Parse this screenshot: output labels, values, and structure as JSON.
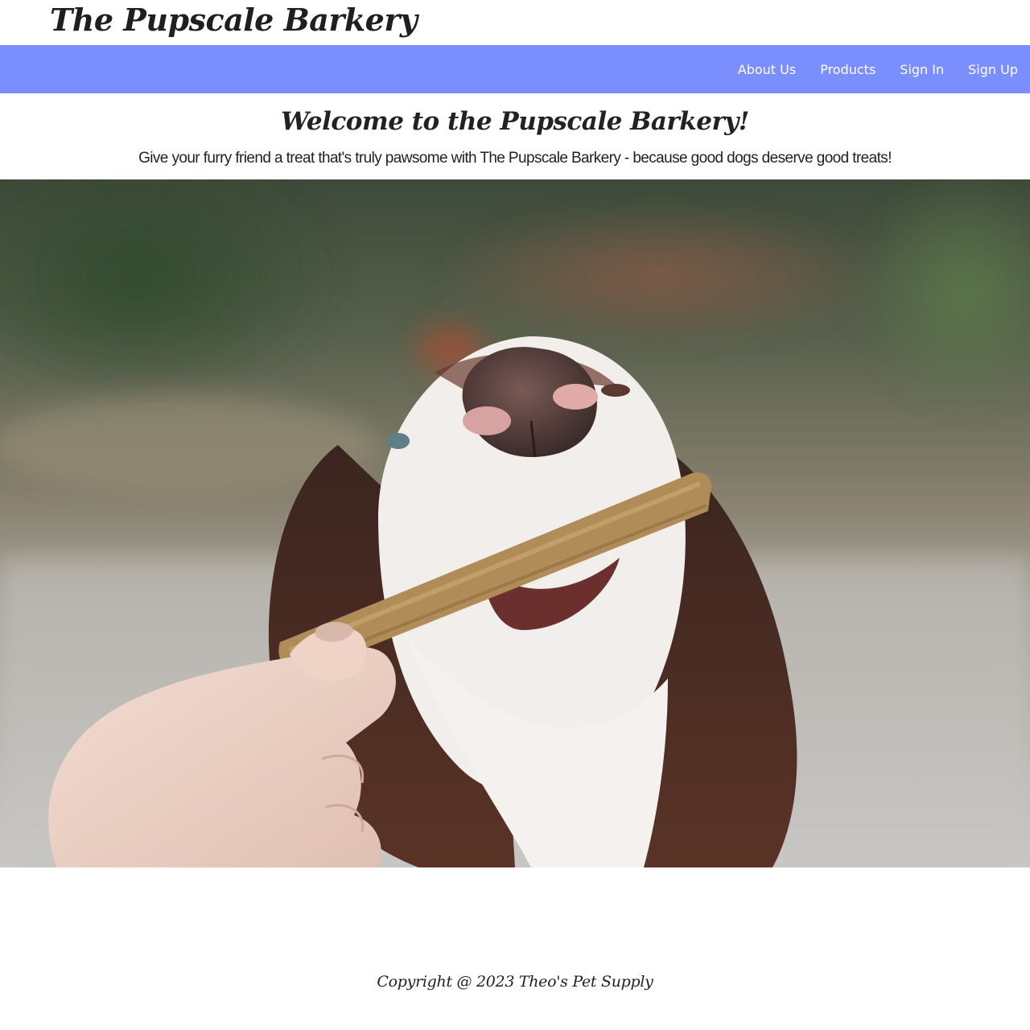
{
  "header": {
    "brand": "The Pupscale Barkery"
  },
  "nav": {
    "items": [
      {
        "label": "About Us"
      },
      {
        "label": "Products"
      },
      {
        "label": "Sign In"
      },
      {
        "label": "Sign Up"
      }
    ],
    "background_color": "#7a8efe",
    "link_color": "#ffffff"
  },
  "hero": {
    "heading": "Welcome to the Pupscale Barkery!",
    "subheading": "Give your furry friend a treat that's truly pawsome with The Pupscale Barkery - because good dogs deserve good treats!"
  },
  "footer": {
    "copyright": "Copyright @ 2023 Theo's Pet Supply"
  }
}
